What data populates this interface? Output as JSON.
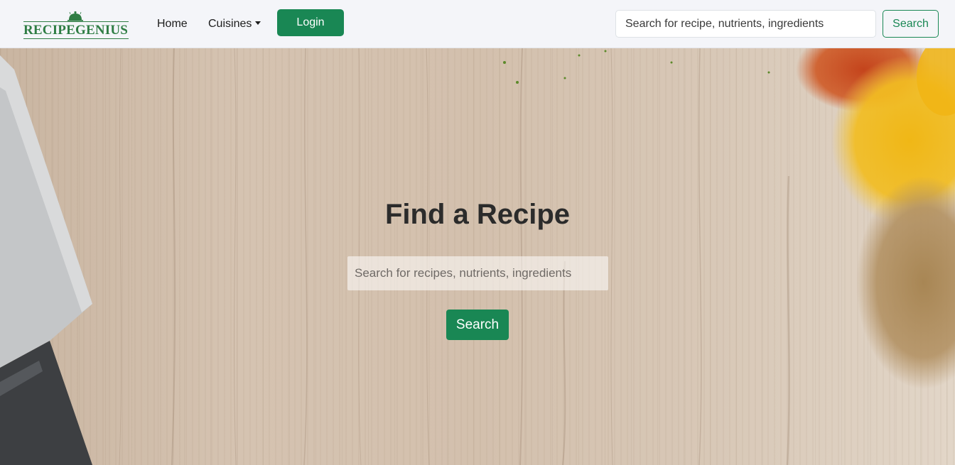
{
  "brand": {
    "name": "RECIPEGENIUS",
    "icon": "cloche-icon"
  },
  "nav": {
    "home_label": "Home",
    "cuisines_label": "Cuisines",
    "login_label": "Login",
    "search_placeholder": "Search for recipe, nutrients, ingredients",
    "search_button": "Search"
  },
  "hero": {
    "title": "Find a Recipe",
    "search_placeholder": "Search for recipes, nutrients, ingredients",
    "search_button": "Search"
  },
  "colors": {
    "accent": "#198754",
    "brand": "#2f7d44",
    "navbar_bg": "#f4f5f9"
  }
}
